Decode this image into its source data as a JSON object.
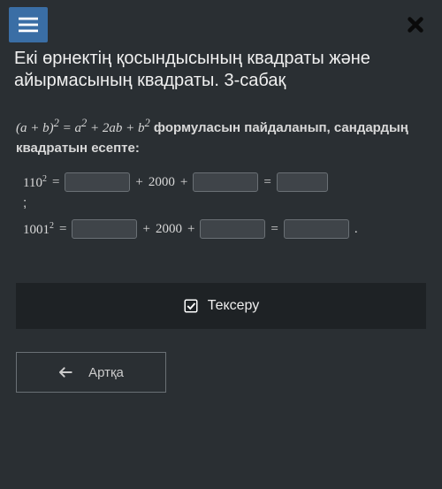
{
  "header": {
    "menu_icon": "menu-icon",
    "close_icon": "close-icon"
  },
  "title": "Екі өрнектің қосындысының квадраты және айырмасының квадраты. 3-сабақ",
  "instruction": {
    "formula_lhs": "(a + b)",
    "formula_sup": "2",
    "formula_eq": " = a",
    "formula_sup2": "2",
    "formula_mid": " + 2ab + b",
    "formula_sup3": "2",
    "tail": " формуласын пайдаланып, сандардың квадратын есепте:"
  },
  "eq1": {
    "base": "110",
    "sup": "2",
    "eq": "=",
    "plus": "+",
    "middle": "2000",
    "end_eq": "=",
    "terminator": ";"
  },
  "eq2": {
    "base": "1001",
    "sup": "2",
    "eq": "=",
    "plus": "+",
    "middle": "2000",
    "end_eq": "=",
    "terminator": "."
  },
  "buttons": {
    "check": "Тексеру",
    "back": "Артқа"
  }
}
